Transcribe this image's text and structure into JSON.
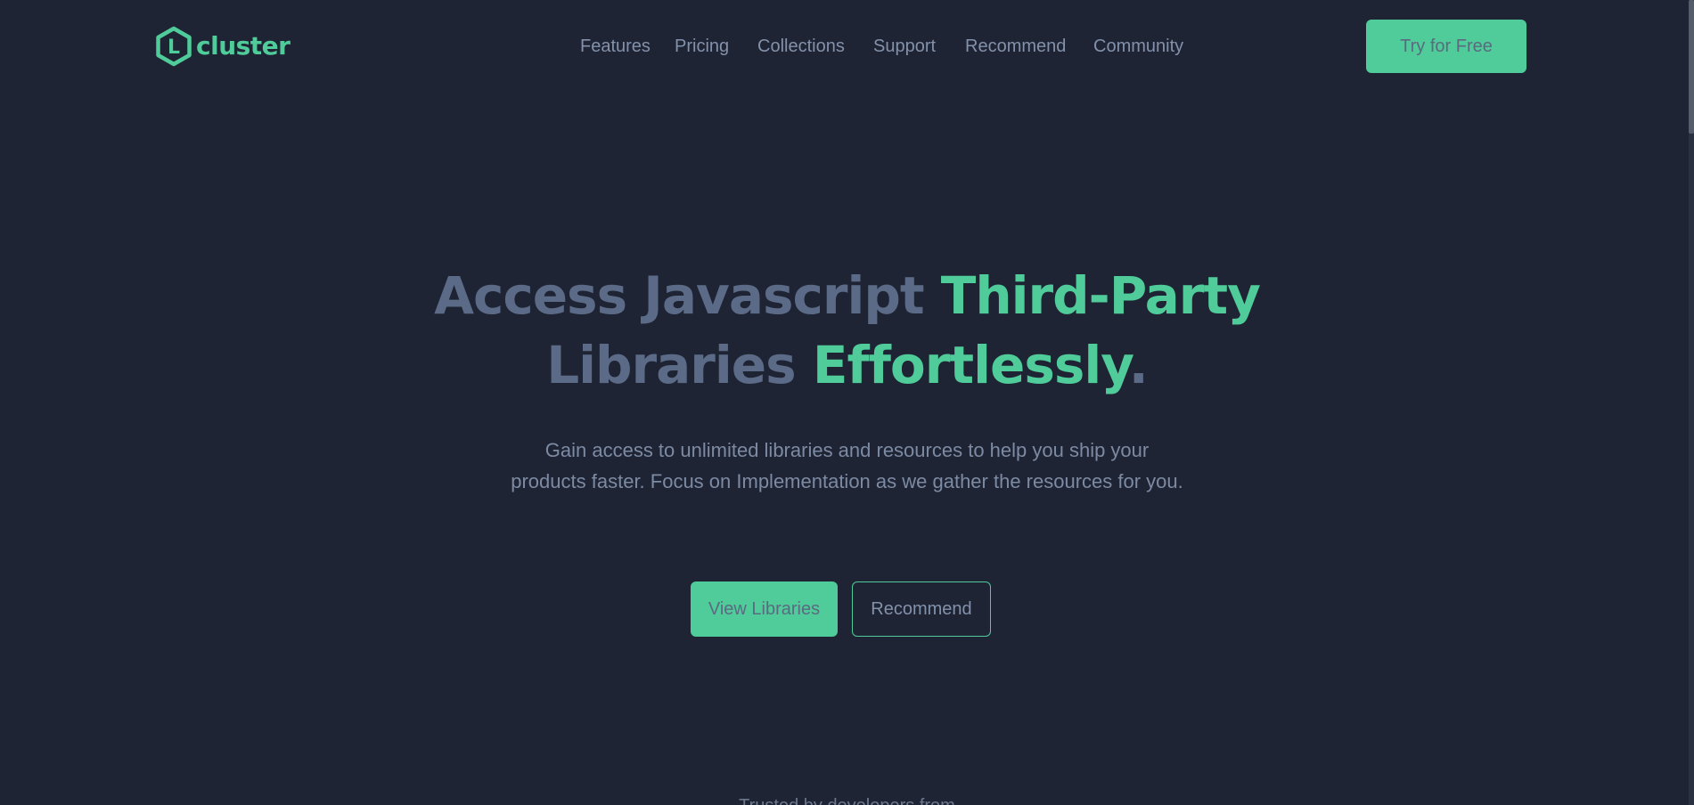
{
  "header": {
    "logo_text": "cluster",
    "logo_mark_letter": "L",
    "nav": [
      "Features",
      "Pricing",
      "Collections",
      "Support",
      "Recommend",
      "Community"
    ],
    "cta": "Try for Free"
  },
  "hero": {
    "title": {
      "part1": "Access Javascript ",
      "accent1": "Third-Party",
      "part2": "Libraries ",
      "accent2": "Effortlessly",
      "end": "."
    },
    "subtitle": "Gain access to unlimited libraries and resources to help you ship your products faster. Focus on Implementation as we gather the resources for you.",
    "primary_button": "View Libraries",
    "secondary_button": "Recommend"
  },
  "trusted_text": "Trusted by developers from",
  "colors": {
    "background": "#1e2433",
    "accent": "#4fcc9a",
    "muted_text": "#5b6b87"
  }
}
